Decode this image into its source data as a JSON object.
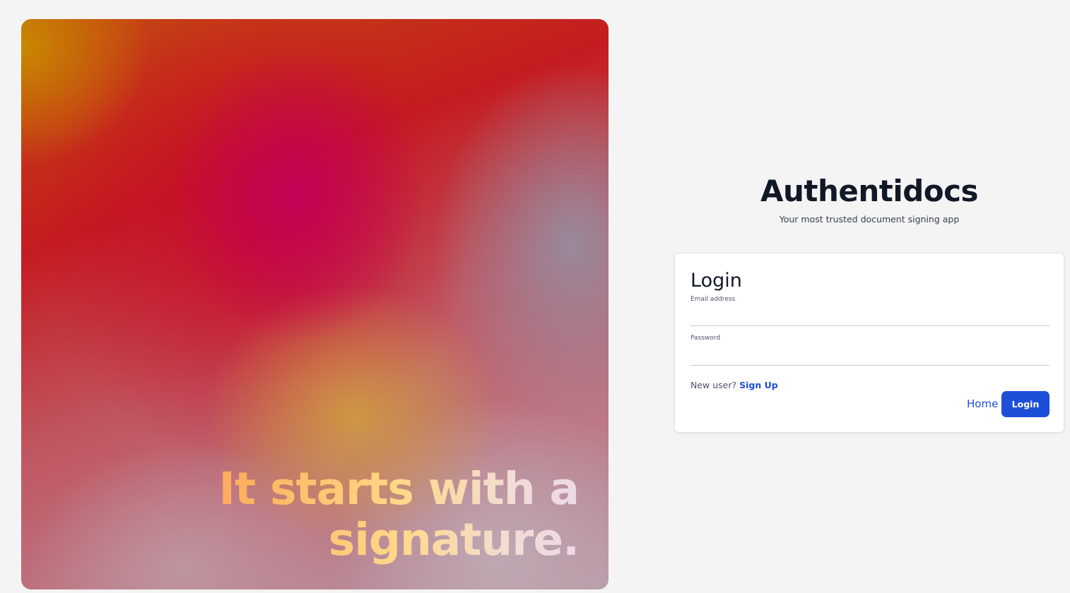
{
  "hero": {
    "caption": "It starts with a signature."
  },
  "brand": {
    "title": "Authentidocs",
    "subtitle": "Your most trusted document signing app"
  },
  "login_form": {
    "title": "Login",
    "email_label": "Email address",
    "email_value": "",
    "password_label": "Password",
    "password_value": "",
    "signup_prompt": "New user?",
    "signup_link": "Sign Up",
    "home_link": "Home",
    "login_button": "Login"
  },
  "colors": {
    "page_background": "#f4f4f4",
    "accent": "#1d4ed8",
    "heading": "#111827"
  }
}
